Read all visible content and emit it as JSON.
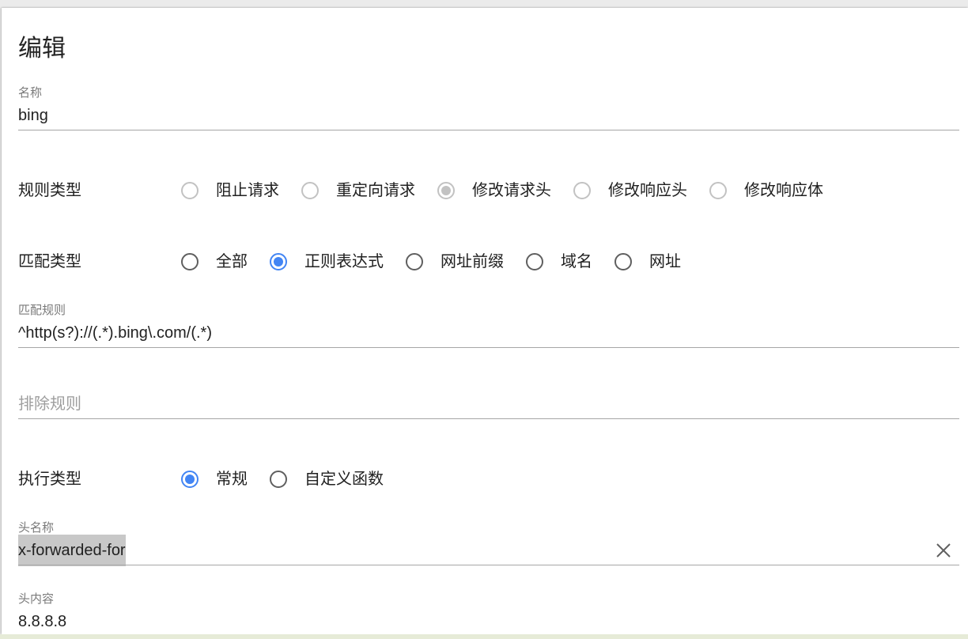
{
  "dialog": {
    "title": "编辑"
  },
  "name_field": {
    "label": "名称",
    "value": "bing"
  },
  "rule_type": {
    "label": "规则类型",
    "options": [
      {
        "label": "阻止请求",
        "checked": false,
        "disabled": true
      },
      {
        "label": "重定向请求",
        "checked": false,
        "disabled": true
      },
      {
        "label": "修改请求头",
        "checked": true,
        "disabled": true
      },
      {
        "label": "修改响应头",
        "checked": false,
        "disabled": true
      },
      {
        "label": "修改响应体",
        "checked": false,
        "disabled": true
      }
    ]
  },
  "match_type": {
    "label": "匹配类型",
    "options": [
      {
        "label": "全部",
        "checked": false,
        "disabled": false
      },
      {
        "label": "正则表达式",
        "checked": true,
        "disabled": false
      },
      {
        "label": "网址前缀",
        "checked": false,
        "disabled": false
      },
      {
        "label": "域名",
        "checked": false,
        "disabled": false
      },
      {
        "label": "网址",
        "checked": false,
        "disabled": false
      }
    ]
  },
  "match_rule_field": {
    "label": "匹配规则",
    "value": "^http(s?)://(.*).bing\\.com/(.*)"
  },
  "exclude_rule_field": {
    "placeholder": "排除规则"
  },
  "exec_type": {
    "label": "执行类型",
    "options": [
      {
        "label": "常规",
        "checked": true,
        "disabled": false
      },
      {
        "label": "自定义函数",
        "checked": false,
        "disabled": false
      }
    ]
  },
  "header_name_field": {
    "label": "头名称",
    "value": "x-forwarded-for",
    "text_selected": true,
    "clear_icon": "clear-icon"
  },
  "header_value_field": {
    "label": "头内容",
    "value": "8.8.8.8"
  },
  "colors": {
    "accent": "#4285f4",
    "disabled": "#c2c2c2",
    "selection": "#c8c8c8"
  }
}
